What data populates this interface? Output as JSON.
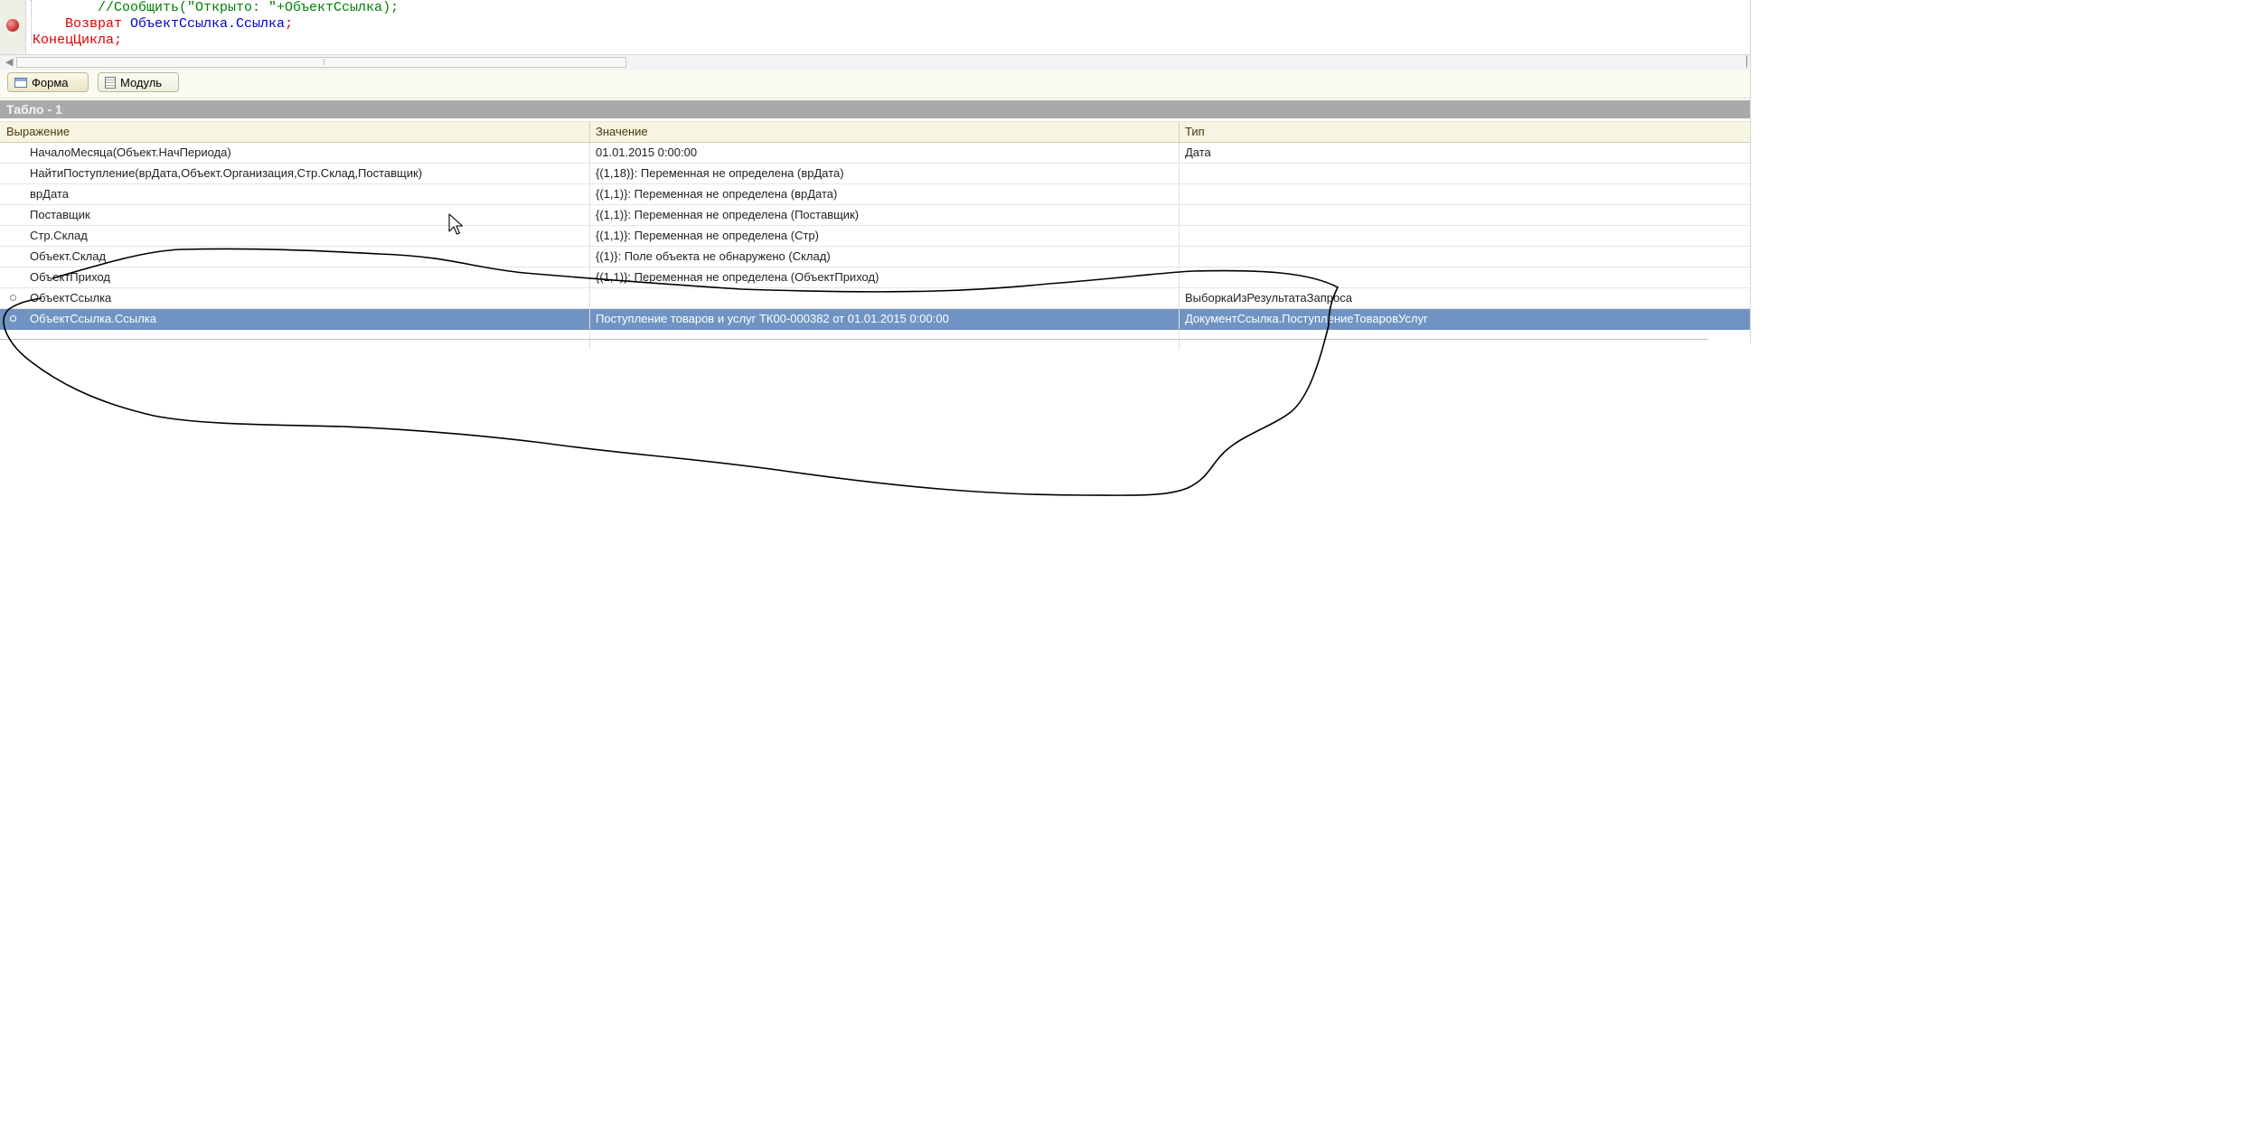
{
  "code": {
    "lines": [
      [
        {
          "t": "        //Сообщить(\"Открыто: \"+ОбъектСсылка);",
          "c": "c-comment"
        }
      ],
      [
        {
          "t": "    Возврат ",
          "c": "c-kw"
        },
        {
          "t": "ОбъектСсылка.Ссылка",
          "c": "c-id"
        },
        {
          "t": ";",
          "c": "c-punct"
        }
      ],
      [
        {
          "t": "КонецЦикла",
          "c": "c-kw"
        },
        {
          "t": ";",
          "c": "c-punct"
        }
      ]
    ]
  },
  "tabs": {
    "form": "Форма",
    "module": "Модуль"
  },
  "panel": {
    "title": "Табло - 1"
  },
  "table": {
    "columns": [
      "Выражение",
      "Значение",
      "Тип"
    ],
    "rows": [
      {
        "expr": "НачалоМесяца(Объект.НачПериода)",
        "value": "01.01.2015 0:00:00",
        "type": "Дата"
      },
      {
        "expr": "НайтиПоступление(врДата,Объект.Организация,Стр.Склад,Поставщик)",
        "value": "{(1,18)}: Переменная не определена (врДата)",
        "type": ""
      },
      {
        "expr": "врДата",
        "value": "{(1,1)}: Переменная не определена (врДата)",
        "type": ""
      },
      {
        "expr": "Поставщик",
        "value": "{(1,1)}: Переменная не определена (Поставщик)",
        "type": ""
      },
      {
        "expr": "Стр.Склад",
        "value": "{(1,1)}: Переменная не определена (Стр)",
        "type": ""
      },
      {
        "expr": "Объект.Склад",
        "value": "{(1)}: Поле объекта не обнаружено (Склад)",
        "type": ""
      },
      {
        "expr": "ОбъектПриход",
        "value": "{(1,1)}: Переменная не определена (ОбъектПриход)",
        "type": ""
      },
      {
        "expr": "ОбъектСсылка",
        "value": "",
        "type": "ВыборкаИзРезультатаЗапроса",
        "expandable": true
      },
      {
        "expr": "ОбъектСсылка.Ссылка",
        "value": "Поступление товаров и услуг ТК00-000382 от 01.01.2015 0:00:00",
        "type": "ДокументСсылка.ПоступлениеТоваровУслуг",
        "expandable": true,
        "selected": true
      }
    ]
  },
  "colors": {
    "selection": "#6f94c3",
    "header_bg": "#f7f4e1",
    "panel_title_bg": "#a9a9a9",
    "annotation_stroke": "#000000"
  },
  "icons": {
    "breakpoint": "breakpoint-icon",
    "form_tab": "form-icon",
    "module_tab": "module-icon",
    "pointer": "mouse-cursor-icon"
  }
}
